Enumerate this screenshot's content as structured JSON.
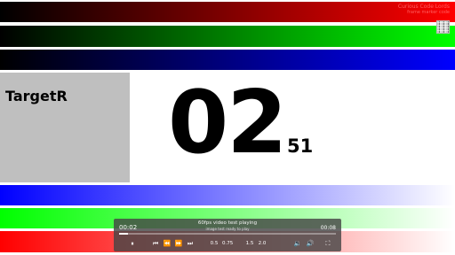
{
  "corner": {
    "line1": "Curious Code Lords",
    "line2": "frame marker code"
  },
  "target": {
    "label": "TargetR"
  },
  "timer": {
    "main": "02",
    "sub": "51"
  },
  "player": {
    "current_time": "00:02",
    "total_time": "00:08",
    "title": "60fps video test playing",
    "subtitle": "image test ready to play",
    "progress": 0.04,
    "rates": [
      "0.5",
      "0.75",
      "1.5",
      "2.0"
    ],
    "icons": {
      "play_pause": "⏸",
      "skip_back": "⏮",
      "rewind": "⏪",
      "forward": "⏩",
      "skip_forward": "⏭",
      "volume_down": "🔉",
      "volume_up": "🔊",
      "fullscreen": "⛶"
    }
  },
  "bars": {
    "colors": [
      "#ff0000",
      "#00ff00",
      "#0000ff"
    ]
  }
}
